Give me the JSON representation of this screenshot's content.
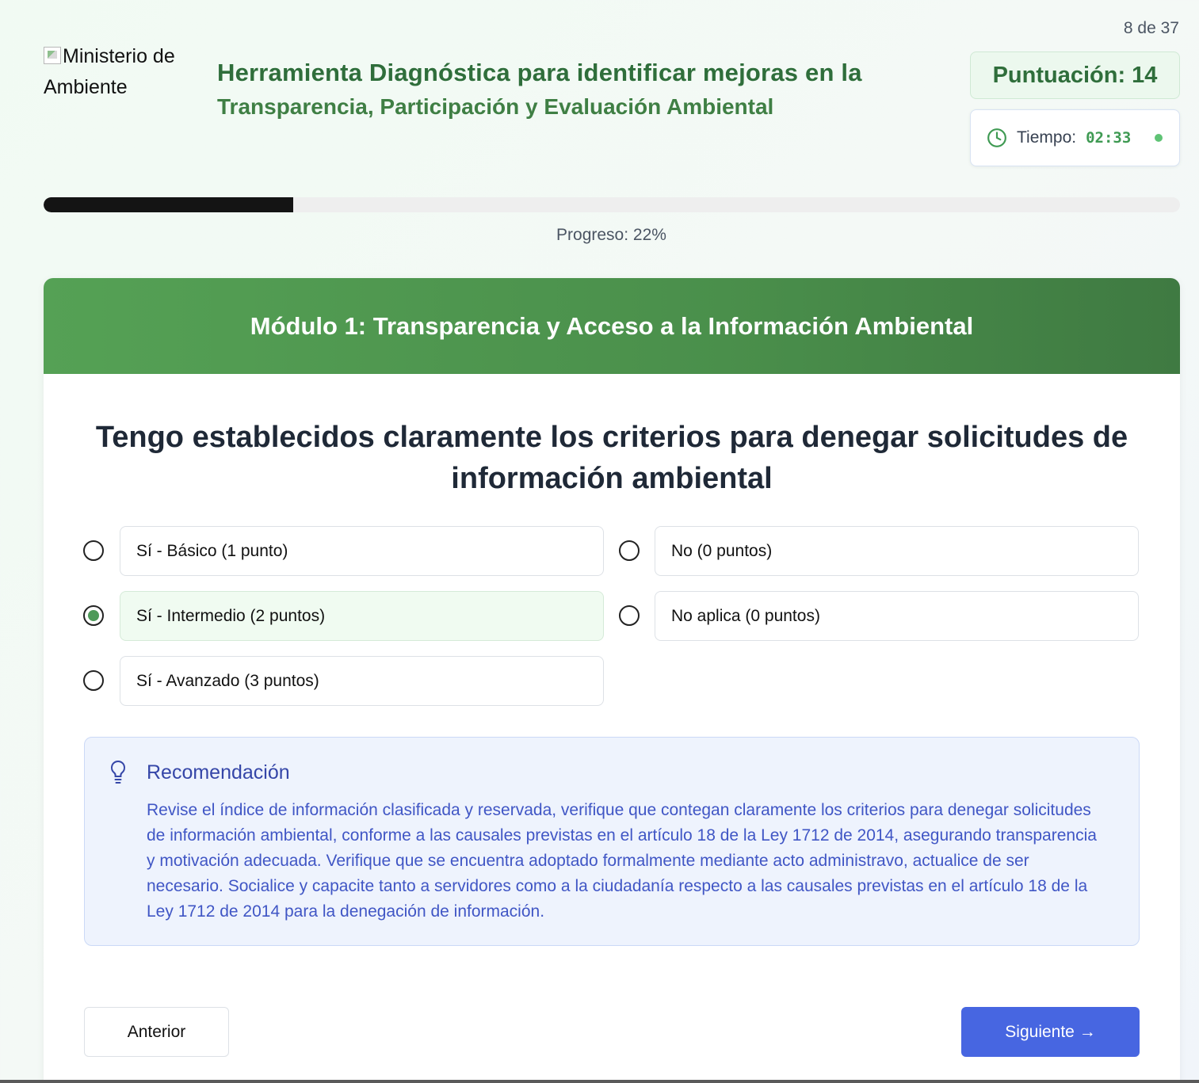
{
  "header": {
    "counter": "8 de 37",
    "logo_alt": "Ministerio de Ambiente",
    "title_line1": "Herramienta Diagnóstica para identificar mejoras en la",
    "title_line2": "Transparencia, Participación y Evaluación Ambiental",
    "score": "Puntuación: 14",
    "timer_label": "Tiempo:",
    "timer_value": "02:33"
  },
  "progress": {
    "percent": 22,
    "label": "Progreso: 22%"
  },
  "module": {
    "title": "Módulo 1: Transparencia y Acceso a la Información Ambiental"
  },
  "question": {
    "text": "Tengo establecidos claramente los criterios para denegar solicitudes de información ambiental"
  },
  "options": [
    {
      "label": "Sí - Básico (1 punto)",
      "selected": false
    },
    {
      "label": "Sí - Intermedio (2 puntos)",
      "selected": true
    },
    {
      "label": "Sí - Avanzado (3 puntos)",
      "selected": false
    },
    {
      "label": "No (0 puntos)",
      "selected": false
    },
    {
      "label": "No aplica (0 puntos)",
      "selected": false
    }
  ],
  "recommendation": {
    "icon": "lightbulb-icon",
    "title": "Recomendación",
    "body": "Revise el índice de información clasificada y reservada, verifique que contegan claramente los criterios para denegar solicitudes de información ambiental, conforme a las causales previstas en el artículo 18 de la Ley 1712 de 2014, asegurando transparencia y motivación adecuada. Verifique que se encuentra adoptado formalmente mediante acto administravo, actualice de ser necesario. Socialice y capacite tanto a servidores como a la ciudadanía respecto a las causales previstas en el artículo 18 de la Ley 1712 de 2014 para la denegación de información."
  },
  "nav": {
    "prev_label": "Anterior",
    "next_label": "Siguiente →"
  },
  "colors": {
    "brand_green": "#2f6e3b",
    "header_green": "#4a8f4b",
    "primary_blue": "#4766e1",
    "recommendation_blue": "#4056c5"
  }
}
